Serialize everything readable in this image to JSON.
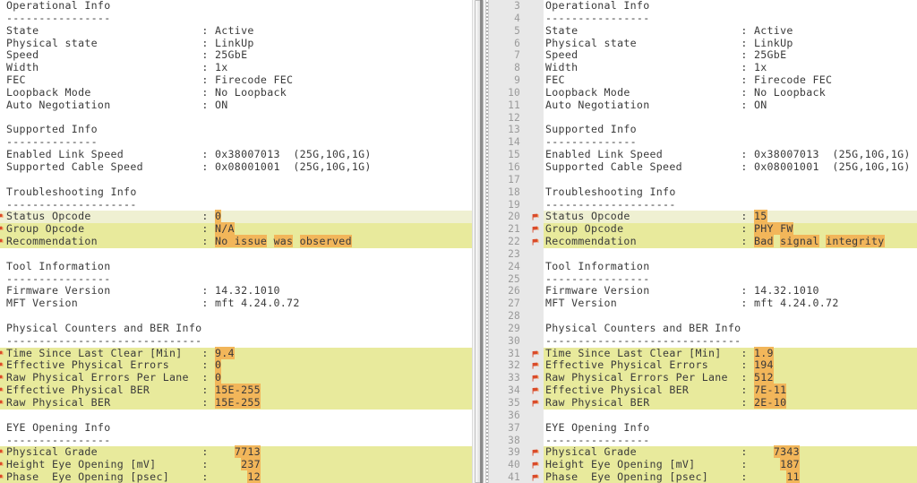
{
  "view": {
    "type": "side-by-side-diff",
    "left_pane_name": "left-diff-pane",
    "right_pane_name": "right-diff-pane",
    "colors": {
      "diff_row_bg": "#e8ea9c",
      "diff_row_bg_soft": "#eff0d2",
      "word_highlight_bg": "#f2b65a",
      "gutter_bg": "#e8e8e8",
      "text": "#3a3a3a",
      "line_number": "#9a9a9a",
      "change_marker": "#d94b2b"
    },
    "marker_icon": "change-marker-icon"
  },
  "left": {
    "lines": [
      {
        "n": "",
        "mark": false,
        "diff": "none",
        "segs": [
          {
            "t": "Operational Info"
          }
        ]
      },
      {
        "n": "",
        "mark": false,
        "diff": "none",
        "segs": [
          {
            "t": "----------------"
          }
        ]
      },
      {
        "n": "",
        "mark": false,
        "diff": "none",
        "segs": [
          {
            "t": "State                         : Active"
          }
        ]
      },
      {
        "n": "",
        "mark": false,
        "diff": "none",
        "segs": [
          {
            "t": "Physical state                : LinkUp"
          }
        ]
      },
      {
        "n": "",
        "mark": false,
        "diff": "none",
        "segs": [
          {
            "t": "Speed                         : 25GbE"
          }
        ]
      },
      {
        "n": "",
        "mark": false,
        "diff": "none",
        "segs": [
          {
            "t": "Width                         : 1x"
          }
        ]
      },
      {
        "n": "",
        "mark": false,
        "diff": "none",
        "segs": [
          {
            "t": "FEC                           : Firecode FEC"
          }
        ]
      },
      {
        "n": "",
        "mark": false,
        "diff": "none",
        "segs": [
          {
            "t": "Loopback Mode                 : No Loopback"
          }
        ]
      },
      {
        "n": "",
        "mark": false,
        "diff": "none",
        "segs": [
          {
            "t": "Auto Negotiation              : ON"
          }
        ]
      },
      {
        "n": "",
        "mark": false,
        "diff": "none",
        "segs": [
          {
            "t": ""
          }
        ]
      },
      {
        "n": "",
        "mark": false,
        "diff": "none",
        "segs": [
          {
            "t": "Supported Info"
          }
        ]
      },
      {
        "n": "",
        "mark": false,
        "diff": "none",
        "segs": [
          {
            "t": "--------------"
          }
        ]
      },
      {
        "n": "",
        "mark": false,
        "diff": "none",
        "segs": [
          {
            "t": "Enabled Link Speed            : 0x38007013  (25G,10G,1G)"
          }
        ]
      },
      {
        "n": "",
        "mark": false,
        "diff": "none",
        "segs": [
          {
            "t": "Supported Cable Speed         : 0x08001001  (25G,10G,1G)"
          }
        ]
      },
      {
        "n": "",
        "mark": false,
        "diff": "none",
        "segs": [
          {
            "t": ""
          }
        ]
      },
      {
        "n": "",
        "mark": false,
        "diff": "none",
        "segs": [
          {
            "t": "Troubleshooting Info"
          }
        ]
      },
      {
        "n": "",
        "mark": false,
        "diff": "none",
        "segs": [
          {
            "t": "--------------------"
          }
        ]
      },
      {
        "n": "",
        "mark": true,
        "diff": "soft",
        "segs": [
          {
            "t": "Status Opcode                 : "
          },
          {
            "t": "0",
            "hl": true
          }
        ]
      },
      {
        "n": "",
        "mark": true,
        "diff": "full",
        "segs": [
          {
            "t": "Group Opcode                  : "
          },
          {
            "t": "N/A",
            "hl": true
          }
        ]
      },
      {
        "n": "",
        "mark": true,
        "diff": "full",
        "segs": [
          {
            "t": "Recommendation                : "
          },
          {
            "t": "No issue",
            "hl": true
          },
          {
            "t": " "
          },
          {
            "t": "was",
            "hl": true
          },
          {
            "t": " "
          },
          {
            "t": "observed",
            "hl": true
          }
        ]
      },
      {
        "n": "",
        "mark": false,
        "diff": "none",
        "segs": [
          {
            "t": ""
          }
        ]
      },
      {
        "n": "",
        "mark": false,
        "diff": "none",
        "segs": [
          {
            "t": "Tool Information"
          }
        ]
      },
      {
        "n": "",
        "mark": false,
        "diff": "none",
        "segs": [
          {
            "t": "----------------"
          }
        ]
      },
      {
        "n": "",
        "mark": false,
        "diff": "none",
        "segs": [
          {
            "t": "Firmware Version              : 14.32.1010"
          }
        ]
      },
      {
        "n": "",
        "mark": false,
        "diff": "none",
        "segs": [
          {
            "t": "MFT Version                   : mft 4.24.0.72"
          }
        ]
      },
      {
        "n": "",
        "mark": false,
        "diff": "none",
        "segs": [
          {
            "t": ""
          }
        ]
      },
      {
        "n": "",
        "mark": false,
        "diff": "none",
        "segs": [
          {
            "t": "Physical Counters and BER Info"
          }
        ]
      },
      {
        "n": "",
        "mark": false,
        "diff": "none",
        "segs": [
          {
            "t": "------------------------------"
          }
        ]
      },
      {
        "n": "",
        "mark": true,
        "diff": "full",
        "segs": [
          {
            "t": "Time Since Last Clear [Min]   : "
          },
          {
            "t": "9.4",
            "hl": true
          }
        ]
      },
      {
        "n": "",
        "mark": true,
        "diff": "full",
        "segs": [
          {
            "t": "Effective Physical Errors     : "
          },
          {
            "t": "0",
            "hl": true
          }
        ]
      },
      {
        "n": "",
        "mark": true,
        "diff": "full",
        "segs": [
          {
            "t": "Raw Physical Errors Per Lane  : "
          },
          {
            "t": "0",
            "hl": true
          }
        ]
      },
      {
        "n": "",
        "mark": true,
        "diff": "full",
        "segs": [
          {
            "t": "Effective Physical BER        : "
          },
          {
            "t": "15E-",
            "hl": true
          },
          {
            "t": "255",
            "hl": true
          }
        ]
      },
      {
        "n": "",
        "mark": true,
        "diff": "full",
        "segs": [
          {
            "t": "Raw Physical BER              : "
          },
          {
            "t": "15E-",
            "hl": true
          },
          {
            "t": "255",
            "hl": true
          }
        ]
      },
      {
        "n": "",
        "mark": false,
        "diff": "none",
        "segs": [
          {
            "t": ""
          }
        ]
      },
      {
        "n": "",
        "mark": false,
        "diff": "none",
        "segs": [
          {
            "t": "EYE Opening Info"
          }
        ]
      },
      {
        "n": "",
        "mark": false,
        "diff": "none",
        "segs": [
          {
            "t": "----------------"
          }
        ]
      },
      {
        "n": "",
        "mark": true,
        "diff": "full",
        "segs": [
          {
            "t": "Physical Grade                :    "
          },
          {
            "t": "7713",
            "hl": true
          }
        ]
      },
      {
        "n": "",
        "mark": true,
        "diff": "full",
        "segs": [
          {
            "t": "Height Eye Opening [mV]       :     "
          },
          {
            "t": "237",
            "hl": true
          }
        ]
      },
      {
        "n": "",
        "mark": true,
        "diff": "full",
        "segs": [
          {
            "t": "Phase  Eye Opening [psec]     :      "
          },
          {
            "t": "12",
            "hl": true
          }
        ]
      }
    ]
  },
  "right": {
    "lines": [
      {
        "n": "3",
        "mark": false,
        "diff": "none",
        "segs": [
          {
            "t": "Operational Info"
          }
        ]
      },
      {
        "n": "4",
        "mark": false,
        "diff": "none",
        "segs": [
          {
            "t": "----------------"
          }
        ]
      },
      {
        "n": "5",
        "mark": false,
        "diff": "none",
        "segs": [
          {
            "t": "State                         : Active"
          }
        ]
      },
      {
        "n": "6",
        "mark": false,
        "diff": "none",
        "segs": [
          {
            "t": "Physical state                : LinkUp"
          }
        ]
      },
      {
        "n": "7",
        "mark": false,
        "diff": "none",
        "segs": [
          {
            "t": "Speed                         : 25GbE"
          }
        ]
      },
      {
        "n": "8",
        "mark": false,
        "diff": "none",
        "segs": [
          {
            "t": "Width                         : 1x"
          }
        ]
      },
      {
        "n": "9",
        "mark": false,
        "diff": "none",
        "segs": [
          {
            "t": "FEC                           : Firecode FEC"
          }
        ]
      },
      {
        "n": "10",
        "mark": false,
        "diff": "none",
        "segs": [
          {
            "t": "Loopback Mode                 : No Loopback"
          }
        ]
      },
      {
        "n": "11",
        "mark": false,
        "diff": "none",
        "segs": [
          {
            "t": "Auto Negotiation              : ON"
          }
        ]
      },
      {
        "n": "12",
        "mark": false,
        "diff": "none",
        "segs": [
          {
            "t": ""
          }
        ]
      },
      {
        "n": "13",
        "mark": false,
        "diff": "none",
        "segs": [
          {
            "t": "Supported Info"
          }
        ]
      },
      {
        "n": "14",
        "mark": false,
        "diff": "none",
        "segs": [
          {
            "t": "--------------"
          }
        ]
      },
      {
        "n": "15",
        "mark": false,
        "diff": "none",
        "segs": [
          {
            "t": "Enabled Link Speed            : 0x38007013  (25G,10G,1G)"
          }
        ]
      },
      {
        "n": "16",
        "mark": false,
        "diff": "none",
        "segs": [
          {
            "t": "Supported Cable Speed         : 0x08001001  (25G,10G,1G)"
          }
        ]
      },
      {
        "n": "17",
        "mark": false,
        "diff": "none",
        "segs": [
          {
            "t": ""
          }
        ]
      },
      {
        "n": "18",
        "mark": false,
        "diff": "none",
        "segs": [
          {
            "t": "Troubleshooting Info"
          }
        ]
      },
      {
        "n": "19",
        "mark": false,
        "diff": "none",
        "segs": [
          {
            "t": "--------------------"
          }
        ]
      },
      {
        "n": "20",
        "mark": true,
        "diff": "soft",
        "segs": [
          {
            "t": "Status Opcode                 : "
          },
          {
            "t": "15",
            "hl": true
          }
        ]
      },
      {
        "n": "21",
        "mark": true,
        "diff": "full",
        "segs": [
          {
            "t": "Group Opcode                  : "
          },
          {
            "t": "PHY FW",
            "hl": true
          }
        ]
      },
      {
        "n": "22",
        "mark": true,
        "diff": "full",
        "segs": [
          {
            "t": "Recommendation                : "
          },
          {
            "t": "Bad",
            "hl": true
          },
          {
            "t": " "
          },
          {
            "t": "signal",
            "hl": true
          },
          {
            "t": " "
          },
          {
            "t": "integrity",
            "hl": true
          }
        ]
      },
      {
        "n": "23",
        "mark": false,
        "diff": "none",
        "segs": [
          {
            "t": ""
          }
        ]
      },
      {
        "n": "24",
        "mark": false,
        "diff": "none",
        "segs": [
          {
            "t": "Tool Information"
          }
        ]
      },
      {
        "n": "25",
        "mark": false,
        "diff": "none",
        "segs": [
          {
            "t": "----------------"
          }
        ]
      },
      {
        "n": "26",
        "mark": false,
        "diff": "none",
        "segs": [
          {
            "t": "Firmware Version              : 14.32.1010"
          }
        ]
      },
      {
        "n": "27",
        "mark": false,
        "diff": "none",
        "segs": [
          {
            "t": "MFT Version                   : mft 4.24.0.72"
          }
        ]
      },
      {
        "n": "28",
        "mark": false,
        "diff": "none",
        "segs": [
          {
            "t": ""
          }
        ]
      },
      {
        "n": "29",
        "mark": false,
        "diff": "none",
        "segs": [
          {
            "t": "Physical Counters and BER Info"
          }
        ]
      },
      {
        "n": "30",
        "mark": false,
        "diff": "none",
        "segs": [
          {
            "t": "------------------------------"
          }
        ]
      },
      {
        "n": "31",
        "mark": true,
        "diff": "full",
        "segs": [
          {
            "t": "Time Since Last Clear [Min]   : "
          },
          {
            "t": "1.9",
            "hl": true
          }
        ]
      },
      {
        "n": "32",
        "mark": true,
        "diff": "full",
        "segs": [
          {
            "t": "Effective Physical Errors     : "
          },
          {
            "t": "194",
            "hl": true
          }
        ]
      },
      {
        "n": "33",
        "mark": true,
        "diff": "full",
        "segs": [
          {
            "t": "Raw Physical Errors Per Lane  : "
          },
          {
            "t": "512",
            "hl": true
          }
        ]
      },
      {
        "n": "34",
        "mark": true,
        "diff": "full",
        "segs": [
          {
            "t": "Effective Physical BER        : "
          },
          {
            "t": "7E-",
            "hl": true
          },
          {
            "t": "11",
            "hl": true
          }
        ]
      },
      {
        "n": "35",
        "mark": true,
        "diff": "full",
        "segs": [
          {
            "t": "Raw Physical BER              : "
          },
          {
            "t": "2E-",
            "hl": true
          },
          {
            "t": "10",
            "hl": true
          }
        ]
      },
      {
        "n": "36",
        "mark": false,
        "diff": "none",
        "segs": [
          {
            "t": ""
          }
        ]
      },
      {
        "n": "37",
        "mark": false,
        "diff": "none",
        "segs": [
          {
            "t": "EYE Opening Info"
          }
        ]
      },
      {
        "n": "38",
        "mark": false,
        "diff": "none",
        "segs": [
          {
            "t": "----------------"
          }
        ]
      },
      {
        "n": "39",
        "mark": true,
        "diff": "full",
        "segs": [
          {
            "t": "Physical Grade                :    "
          },
          {
            "t": "7343",
            "hl": true
          }
        ]
      },
      {
        "n": "40",
        "mark": true,
        "diff": "full",
        "segs": [
          {
            "t": "Height Eye Opening [mV]       :     "
          },
          {
            "t": "187",
            "hl": true
          }
        ]
      },
      {
        "n": "41",
        "mark": true,
        "diff": "full",
        "segs": [
          {
            "t": "Phase  Eye Opening [psec]     :      "
          },
          {
            "t": "11",
            "hl": true
          }
        ]
      }
    ]
  }
}
